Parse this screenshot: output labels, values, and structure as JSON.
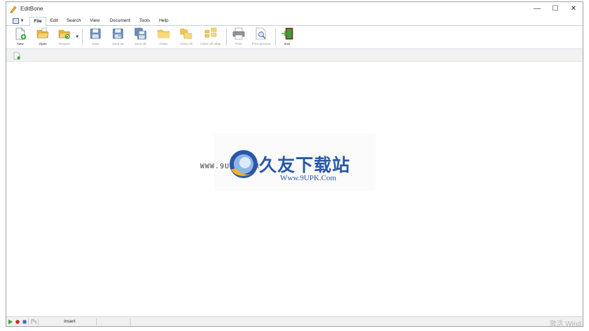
{
  "window": {
    "title": "EditBone"
  },
  "window_controls": {
    "minimize": "—",
    "maximize": "☐",
    "close": "✕"
  },
  "tabs": [
    {
      "label": "File"
    },
    {
      "label": "Edit"
    },
    {
      "label": "Search"
    },
    {
      "label": "View"
    },
    {
      "label": "Document"
    },
    {
      "label": "Tools"
    },
    {
      "label": "Help"
    }
  ],
  "ribbon": {
    "new": "New",
    "open": "Open",
    "reopen": "Reopen",
    "save": "Save",
    "save_as": "Save as",
    "save_all": "Save all",
    "close": "Close",
    "close_all": "Close all",
    "close_all_other": "Close all other",
    "print": "Print",
    "print_preview": "Print preview",
    "exit": "Exit"
  },
  "watermark": {
    "url_left": "WWW.9UPK.COM",
    "chinese": "久友下载站",
    "url": "Www.9UPK.Com"
  },
  "statusbar": {
    "mode": "Insert",
    "activate": "激活 Wind"
  },
  "colors": {
    "accent": "#2a57a8",
    "folder": "#f2c14e",
    "status_green": "#3aa23a",
    "status_red": "#d0281f"
  }
}
